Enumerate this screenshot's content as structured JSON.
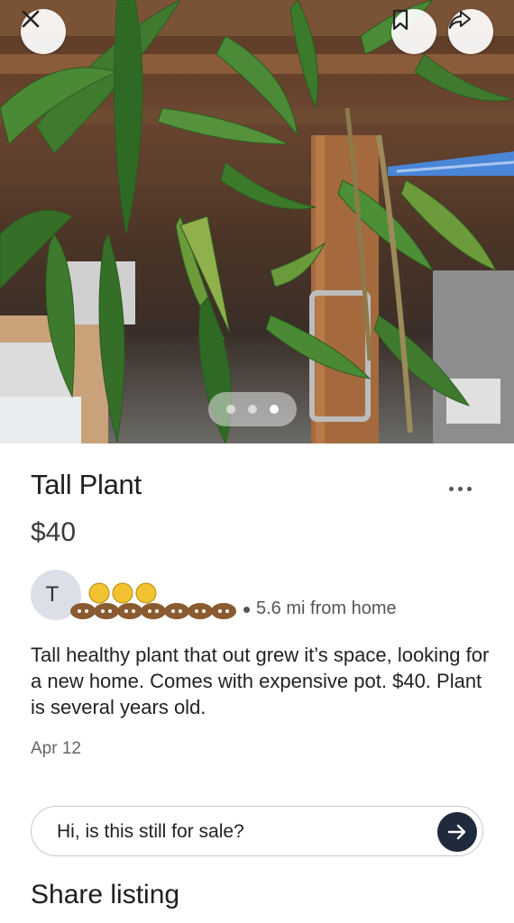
{
  "listing": {
    "title": "Tall Plant",
    "price": "$40",
    "image_pages": 3,
    "active_image_index": 3,
    "description": "Tall healthy plant that out grew it’s space, looking for a new home. Comes with expensive pot. $40. Plant is several years old.",
    "date": "Apr 12"
  },
  "seller": {
    "initial": "T",
    "distance": "5.6 mi from home"
  },
  "message": {
    "value": "Hi, is this still for sale?"
  },
  "sections": {
    "share_heading": "Share listing"
  },
  "icons": {
    "close": "close-icon",
    "save": "bookmark-icon",
    "share": "share-arrow-icon",
    "more": "more-horizontal-icon",
    "send": "arrow-right-icon"
  },
  "colors": {
    "send_button": "#1f2a3d",
    "avatar_bg": "#dcdfe8",
    "leaf_green": "#3f7a2e"
  }
}
